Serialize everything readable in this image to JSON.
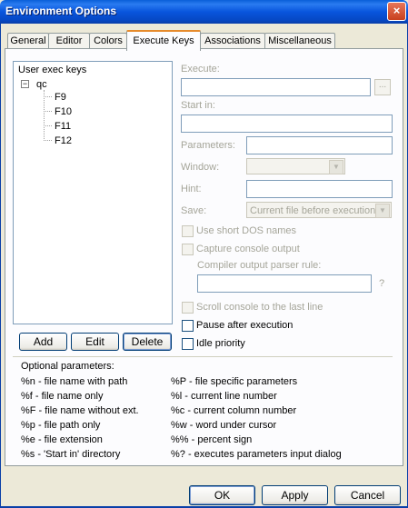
{
  "window": {
    "title": "Environment Options",
    "close_glyph": "×"
  },
  "tabs": [
    "General",
    "Editor",
    "Colors",
    "Execute Keys",
    "Associations",
    "Miscellaneous"
  ],
  "active_tab": "Execute Keys",
  "tree": {
    "header": "User exec keys",
    "expander": "−",
    "root": "qc",
    "children": [
      "F9",
      "F10",
      "F11",
      "F12"
    ]
  },
  "buttons": {
    "add": "Add",
    "edit": "Edit",
    "delete": "Delete",
    "ok": "OK",
    "apply": "Apply",
    "cancel": "Cancel"
  },
  "fields": {
    "execute_label": "Execute:",
    "browse_label": "...",
    "start_in_label": "Start in:",
    "parameters_label": "Parameters:",
    "window_label": "Window:",
    "hint_label": "Hint:",
    "save_label": "Save:",
    "save_value": "Current file before execution",
    "compiler_rule_label": "Compiler output parser rule:",
    "help_glyph": "?"
  },
  "checkboxes": {
    "short_dos": "Use short DOS names",
    "capture": "Capture console output",
    "scroll": "Scroll console to the last line",
    "pause": "Pause after execution",
    "idle": "Idle priority"
  },
  "optional": {
    "title": "Optional parameters:",
    "left": [
      "%n  - file name with path",
      "%f  - file name only",
      "%F  - file name without ext.",
      "%p  - file path only",
      "%e  - file extension",
      "%s  - 'Start in' directory"
    ],
    "right": [
      "%P  - file specific parameters",
      "%l   - current line number",
      "%c  - current column number",
      "%w  - word under cursor",
      "%%  - percent sign",
      "%?  - executes parameters input dialog"
    ]
  }
}
